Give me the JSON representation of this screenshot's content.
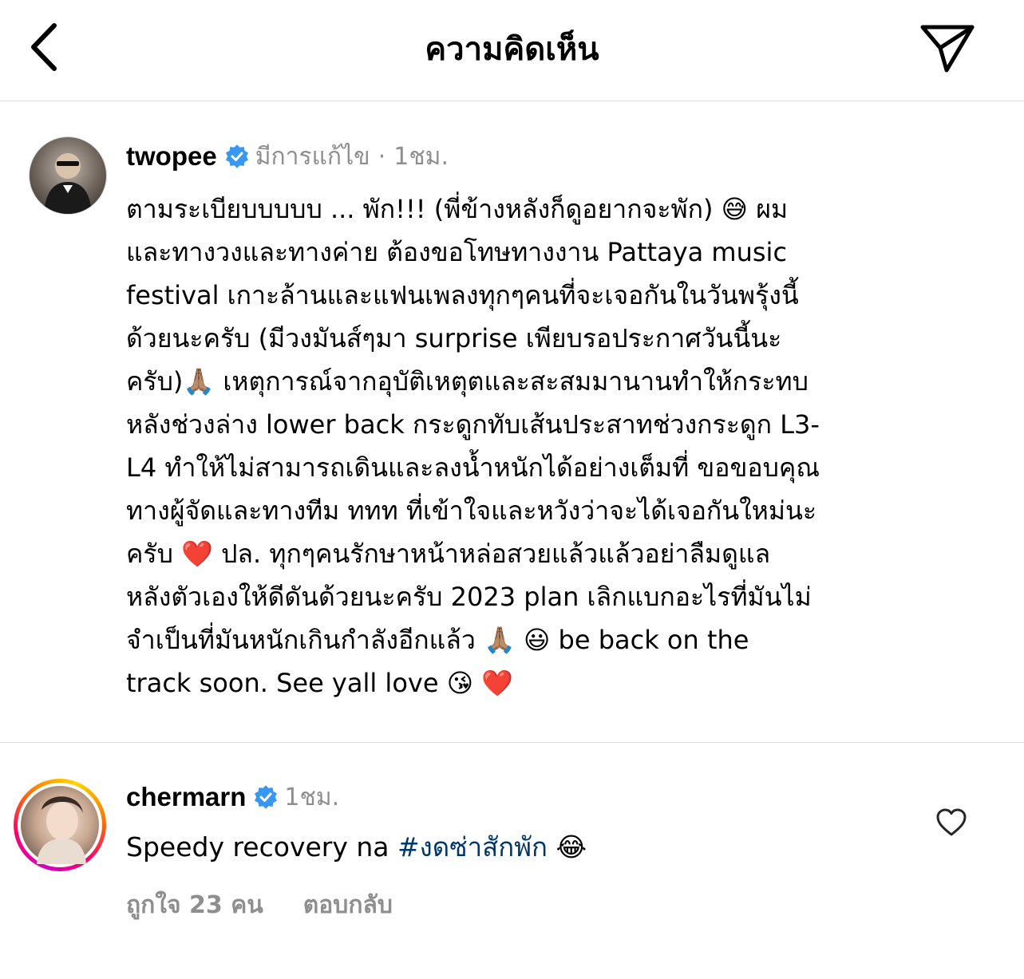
{
  "header": {
    "title": "ความคิดเห็น",
    "back_icon": "chevron-left-icon",
    "share_icon": "paper-plane-icon"
  },
  "comments": [
    {
      "username": "twopee",
      "verified": true,
      "edited_label": "มีการแก้ไข",
      "separator": "·",
      "time": "1ชม.",
      "text": "ตามระเบียบบบบบ ... พัก!!! (พี่ข้างหลังก็ดูอยากจะพัก) 😅 ผม\nและทางวงและทางค่าย ต้องขอโทษทางงาน Pattaya music\nfestival เกาะล้านและแฟนเพลงทุกๆคนที่จะเจอกันในวันพรุ้งนี้\nด้วยนะครับ (มีวงมันส์ๆมา surprise เพียบรอประกาศวันนี้นะ\nครับ)🙏🏽 เหตุการณ์จากอุบัติเหตุตและสะสมมานานทำให้กระทบ\nหลังช่วงล่าง lower back กระดูกทับเส้นประสาทช่วงกระดูก L3-\nL4 ทำให้ไม่สามารถเดินและลงน้ำหนักได้อย่างเต็มที่ ขอขอบคุณ\nทางผู้จัดและทางทีม ททท ที่เข้าใจและหวังว่าจะได้เจอกันใหม่นะ\nครับ ❤️ ปล. ทุกๆคนรักษาหน้าหล่อสวยแล้วแล้วอย่าลืมดูแล\nหลังตัวเองให้ดีดันด้วยนะครับ 2023 plan เลิกแบกอะไรที่มันไม่\nจำเป็นที่มันหนักเกินกำลังอีกแล้ว 🙏🏽 😃 be back on the\ntrack soon. See yall love 😘 ❤️"
    },
    {
      "username": "chermarn",
      "verified": true,
      "time": "1ชม.",
      "text_before": "Speedy recovery na ",
      "hashtag": "#งดซ่าสักพัก",
      "text_after": " 😂",
      "likes_label": "ถูกใจ 23 คน",
      "reply_label": "ตอบกลับ",
      "like_icon": "heart-outline-icon"
    }
  ],
  "colors": {
    "verified": "#3897f0",
    "muted": "#8e8e8e",
    "hashtag": "#00376b",
    "divider": "#dbdbdb"
  }
}
